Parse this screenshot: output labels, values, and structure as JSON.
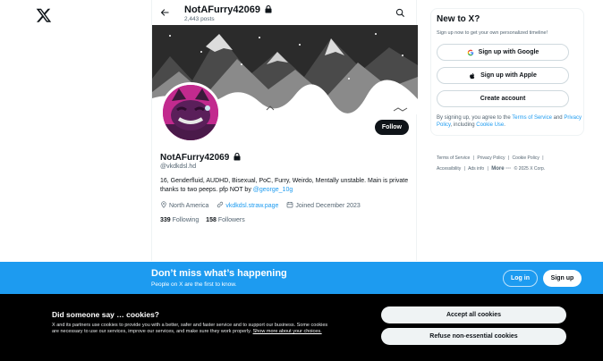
{
  "header": {
    "display_name": "NotAFurry42069",
    "post_count": "2,443 posts"
  },
  "profile": {
    "display_name": "NotAFurry42069",
    "handle": "@vkdkdsl.hd",
    "follow_label": "Follow",
    "bio_text": "16, Genderfluid, AUDHD, Bisexual, PoC, Furry, Weirdo, Mentally unstable. Main is private thanks to two peeps. pfp NOT by ",
    "bio_link": "@george_10g",
    "location": "North America",
    "website": "vkdkdsl.straw.page",
    "joined": "Joined December 2023",
    "following_count": "339",
    "following_label": "Following",
    "followers_count": "158",
    "followers_label": "Followers"
  },
  "sidebar": {
    "title": "New to X?",
    "subtitle": "Sign up now to get your own personalized timeline!",
    "google_label": "Sign up with Google",
    "apple_label": "Sign up with Apple",
    "create_label": "Create account",
    "terms_prefix": "By signing up, you agree to the ",
    "terms_link": "Terms of Service",
    "terms_and": " and ",
    "privacy_link": "Privacy Policy",
    "terms_cookie_prefix": ", including ",
    "cookie_link": "Cookie Use",
    "terms_end": "."
  },
  "footer": {
    "links": [
      "Terms of Service",
      "|",
      "Privacy Policy",
      "|",
      "Cookie Policy",
      "|",
      "Accessibility",
      "|",
      "Ads info",
      "|",
      "More ···",
      "© 2025 X Corp."
    ]
  },
  "signup_bar": {
    "title": "Don’t miss what’s happening",
    "subtitle": "People on X are the first to know.",
    "login_label": "Log in",
    "signup_label": "Sign up"
  },
  "cookies": {
    "title": "Did someone say … cookies?",
    "text": "X and its partners use cookies to provide you with a better, safer and faster service and to support our business. Some cookies are necessary to use our services, improve our services, and make sure they work properly. ",
    "link": "Show more about your choices.",
    "accept_label": "Accept all cookies",
    "refuse_label": "Refuse non-essential cookies"
  },
  "colors": {
    "accent": "#1d9bf0",
    "text": "#0f1419",
    "muted": "#536471"
  },
  "icons": [
    "x-logo-icon",
    "back-arrow-icon",
    "lock-icon",
    "search-icon",
    "location-icon",
    "link-icon",
    "calendar-icon",
    "google-icon",
    "apple-icon"
  ]
}
